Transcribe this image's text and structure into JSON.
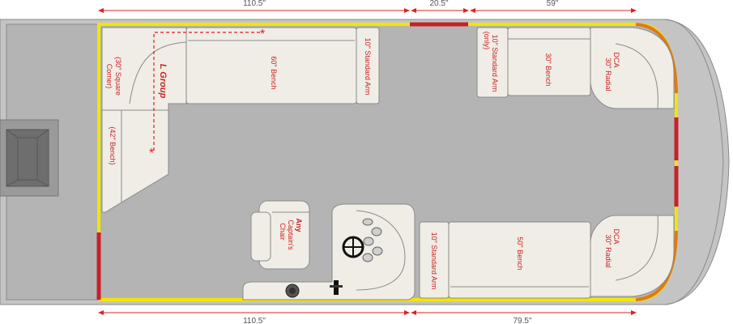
{
  "dimensions": {
    "top_left": "110.5\"",
    "top_mid": "20.5\"",
    "top_right": "59\"",
    "bottom_left": "110.5\"",
    "bottom_right": "79.5\""
  },
  "labels": {
    "l_group": "L Group",
    "corner_a": "(30\" Square",
    "corner_b": "Corner)",
    "bench_42": "(42\" Bench)",
    "bench_60": "60\" Bench",
    "std_arm_top": "10\" Standard Arm",
    "std_arm_only_a": "10\" Standard Arm",
    "std_arm_only_b": "(only)",
    "bench_30": "30\" Bench",
    "radial_top_a": "30\" Radial",
    "radial_top_b": "DCA",
    "radial_bot_a": "30\" Radial",
    "radial_bot_b": "DCA",
    "bench_50": "50\" Bench",
    "std_arm_bottom": "10\" Standard Arm",
    "captain_a": "Any",
    "captain_b": "Captain's",
    "captain_c": "Chair"
  },
  "colors": {
    "deck": "#b4b4b4",
    "rail_yellow": "#f2e600",
    "gate_red": "#c8202a",
    "rail_orange": "#e07a10",
    "label_red": "#cc2222",
    "dimension_red": "#e02020"
  }
}
